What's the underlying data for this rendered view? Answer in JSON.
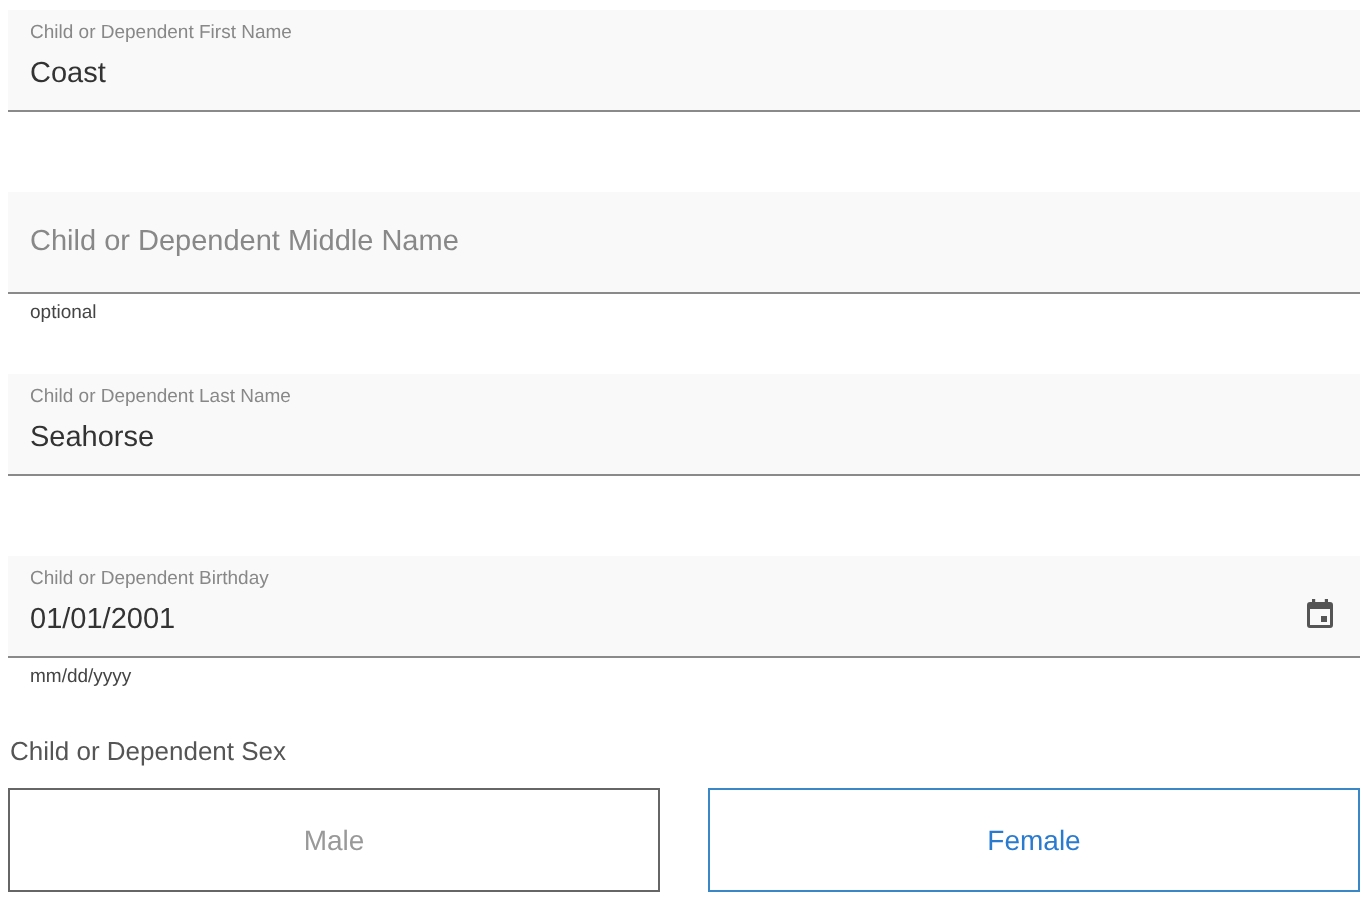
{
  "fields": [
    {
      "kind": "text",
      "label": "Child or Dependent First Name",
      "value": "Coast"
    },
    {
      "kind": "text",
      "placeholder": "Child or Dependent Middle Name",
      "hint": "optional"
    },
    {
      "kind": "text",
      "label": "Child or Dependent Last Name",
      "value": "Seahorse"
    },
    {
      "kind": "date",
      "label": "Child or Dependent Birthday",
      "value": "01/01/2001",
      "hint": "mm/dd/yyyy"
    }
  ],
  "sex": {
    "label": "Child or Dependent Sex",
    "options": [
      {
        "label": "Male",
        "selected": false
      },
      {
        "label": "Female",
        "selected": true
      }
    ]
  }
}
